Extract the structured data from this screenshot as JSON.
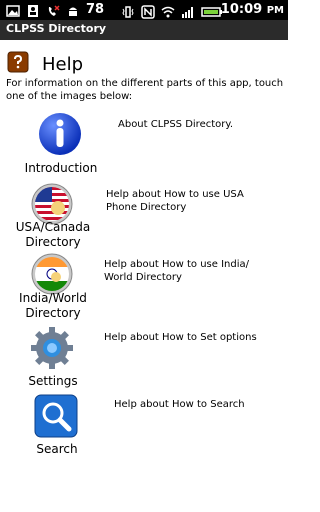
{
  "status": {
    "left_count": "78",
    "time": "10:09",
    "time_suffix": "PM"
  },
  "app": {
    "title": "CLPSS Directory"
  },
  "header": {
    "title": "Help"
  },
  "intro_text": "For information on the different parts of this app, touch one of the images below:",
  "items": [
    {
      "label": "Introduction",
      "description": "About CLPSS Directory."
    },
    {
      "label_line1": "USA/Canada",
      "label_line2": "Directory",
      "description_line1": "Help about How to use USA",
      "description_line2": "Phone Directory"
    },
    {
      "label_line1": "India/World",
      "label_line2": "Directory",
      "description_line1": "Help about How to use India/",
      "description_line2": "World Directory"
    },
    {
      "label": "Settings",
      "description": "Help about How to Set options"
    },
    {
      "label": "Search",
      "description": "Help about How to Search"
    }
  ]
}
